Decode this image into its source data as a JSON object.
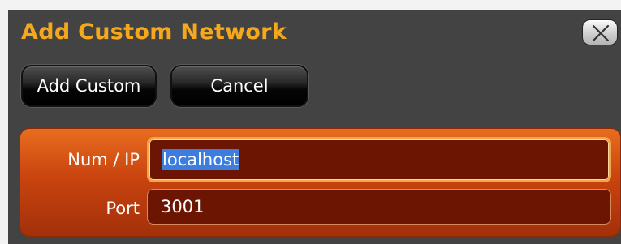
{
  "dialog": {
    "title": "Add Custom Network",
    "close_icon": "close-x-icon"
  },
  "buttons": {
    "add_custom": "Add Custom",
    "cancel": "Cancel"
  },
  "form": {
    "ip_label": "Num / IP",
    "ip_value": "localhost",
    "port_label": "Port",
    "port_value": "3001"
  },
  "colors": {
    "title": "#f6a81c",
    "dialog_bg": "#434343",
    "panel_top": "#e86d1f",
    "panel_bottom": "#a3300a",
    "field_bg": "#6d1503",
    "selection": "#3b7ee0"
  }
}
